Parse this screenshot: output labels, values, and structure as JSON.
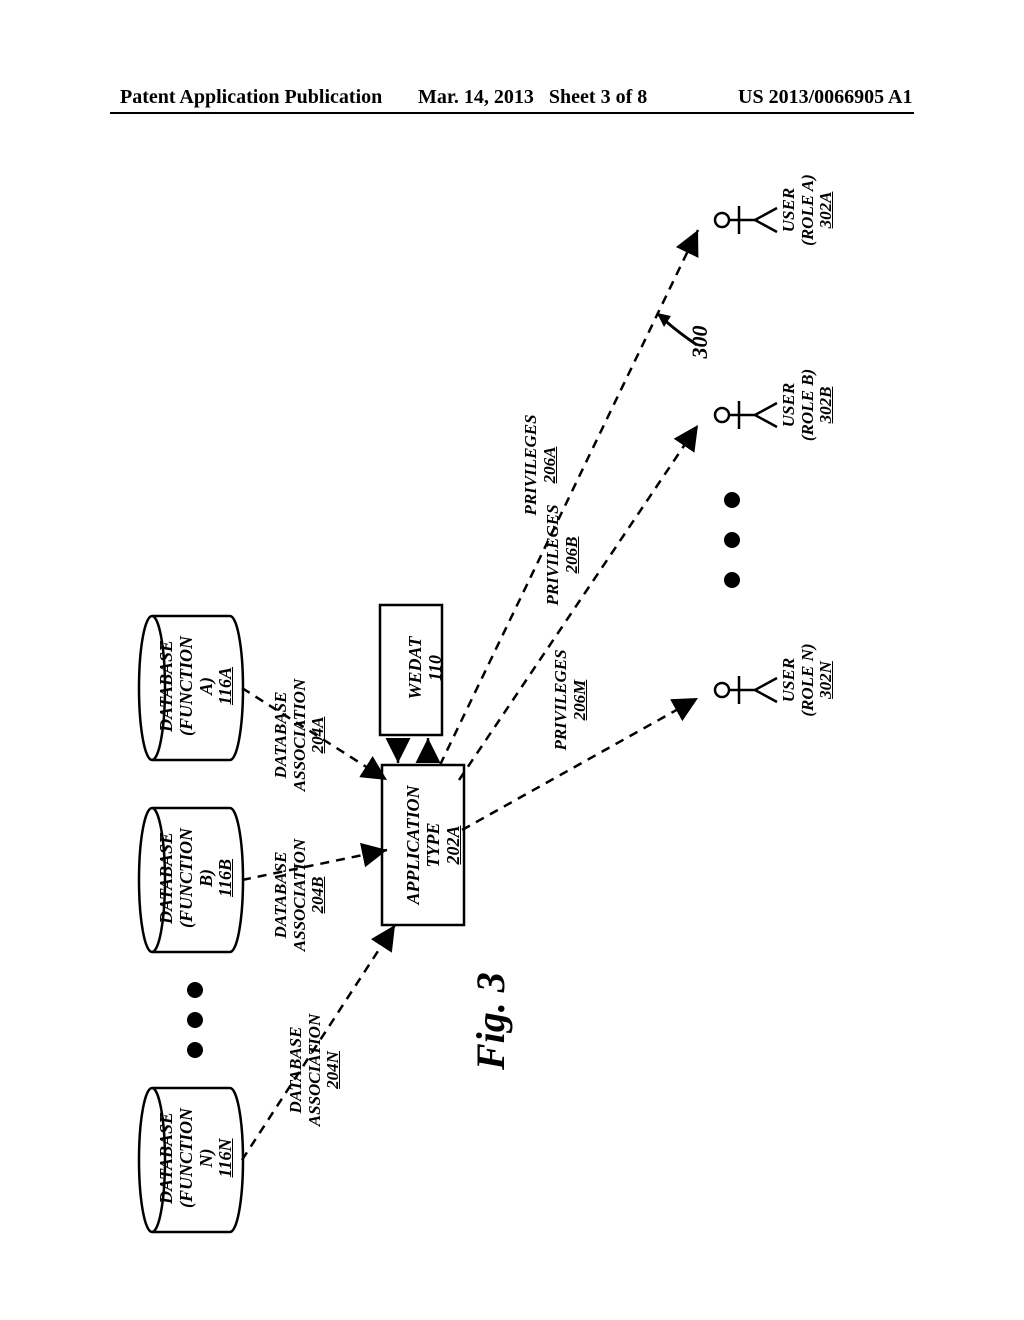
{
  "header": {
    "left": "Patent Application Publication",
    "mid_date": "Mar. 14, 2013",
    "mid_sheet": "Sheet 3 of 8",
    "right": "US 2013/0066905 A1"
  },
  "figure_label": "Fig. 3",
  "ref_300": "300",
  "wedat": {
    "l1": "WEDAT",
    "l2": "110"
  },
  "apptype": {
    "l1": "APPLICATION",
    "l2": "TYPE",
    "l3": "202A"
  },
  "db": {
    "a": {
      "l1": "DATABASE",
      "l2": "(FUNCTION",
      "l3": "A)",
      "l4": "116A"
    },
    "b": {
      "l1": "DATABASE",
      "l2": "(FUNCTION",
      "l3": "B)",
      "l4": "116B"
    },
    "n": {
      "l1": "DATABASE",
      "l2": "(FUNCTION",
      "l3": "N)",
      "l4": "116N"
    }
  },
  "assoc": {
    "a": {
      "l1": "DATABASE",
      "l2": "ASSOCIATION",
      "l3": "204A"
    },
    "b": {
      "l1": "DATABASE",
      "l2": "ASSOCIATION",
      "l3": "204B"
    },
    "n": {
      "l1": "DATABASE",
      "l2": "ASSOCIATION",
      "l3": "204N"
    }
  },
  "priv": {
    "a": {
      "l1": "PRIVILEGES",
      "l2": "206A"
    },
    "b": {
      "l1": "PRIVILEGES",
      "l2": "206B"
    },
    "m": {
      "l1": "PRIVILEGES",
      "l2": "206M"
    }
  },
  "user": {
    "a": {
      "l1": "USER",
      "l2": "(ROLE A)",
      "l3": "302A"
    },
    "b": {
      "l1": "USER",
      "l2": "(ROLE B)",
      "l3": "302B"
    },
    "n": {
      "l1": "USER",
      "l2": "(ROLE N)",
      "l3": "302N"
    }
  }
}
